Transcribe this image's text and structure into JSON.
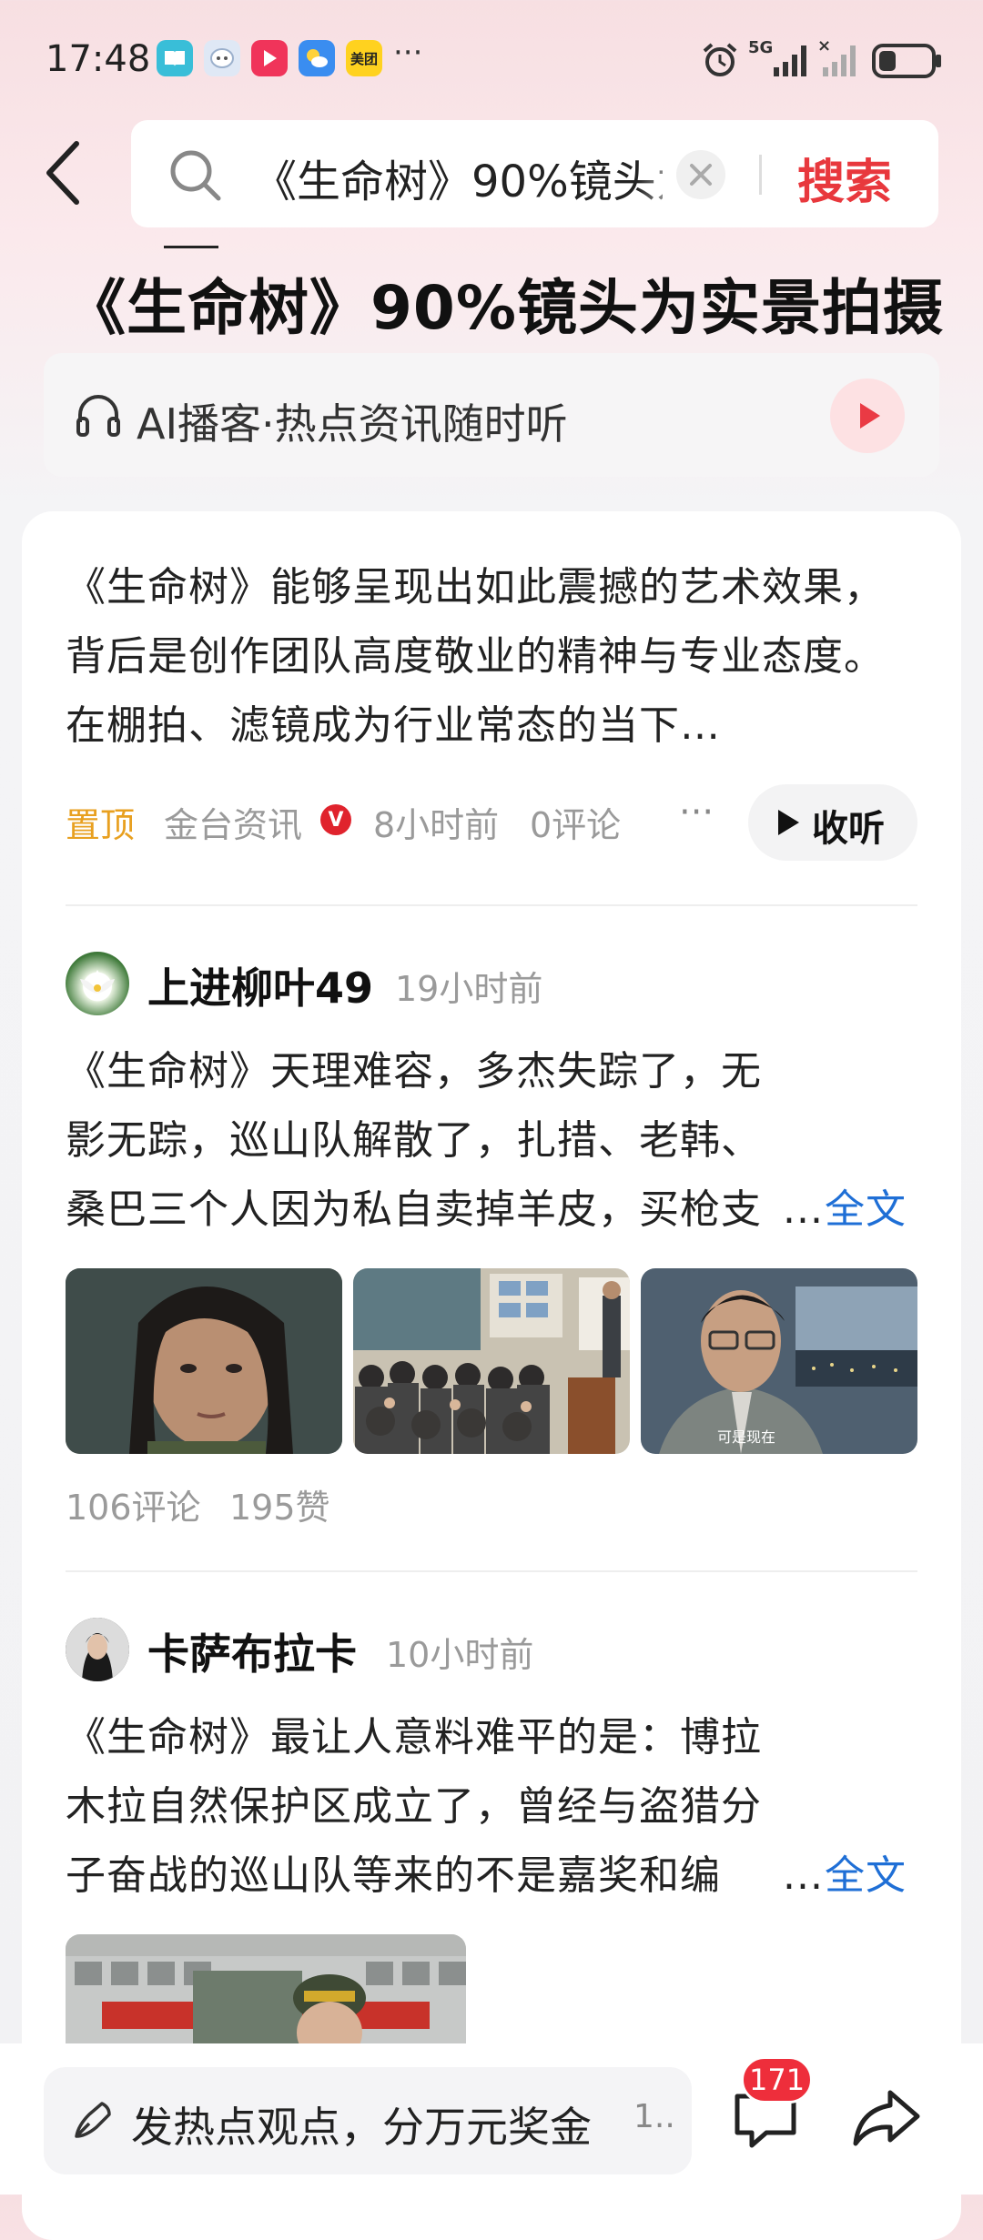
{
  "status_bar": {
    "time": "17:48",
    "app_icons": [
      {
        "name": "reader-app-icon",
        "color": "#3cc0d8"
      },
      {
        "name": "chat-app-icon",
        "color": "#d9e6f7"
      },
      {
        "name": "video-app-icon",
        "color": "#f0345a"
      },
      {
        "name": "weather-app-icon",
        "color": "#3a8df0"
      },
      {
        "name": "meituan-app-icon",
        "color": "#ffd21f",
        "label": "美团"
      }
    ],
    "more": "···",
    "net1": "5G",
    "net2": "×",
    "battery_level": 0.3
  },
  "search": {
    "query": "《生命树》90%镜头为实景拍摄",
    "button": "搜索"
  },
  "page": {
    "title": "《生命树》90%镜头为实景拍摄",
    "ai_podcast": "AI播客·热点资讯随时听"
  },
  "top_article": {
    "text": "《生命树》能够呈现出如此震撼的艺术效果，背后是创作团队高度敬业的精神与专业态度。在棚拍、滤镜成为行业常态的当下…",
    "pin": "置顶",
    "source": "金台资讯",
    "verified": "V",
    "time": "8小时前",
    "comments": "0评论",
    "more": "···",
    "listen": "收听"
  },
  "posts": [
    {
      "user": "上进柳叶49",
      "time": "19小时前",
      "text": "《生命树》天理难容，多杰失踪了，无影无踪，巡山队解散了，扎措、老韩、桑巴三个人因为私自卖掉羊皮，买枪支和子",
      "ellipsis": "...",
      "full": "全文",
      "images": [
        {
          "name": "still-woman-closeup"
        },
        {
          "name": "still-meeting-room"
        },
        {
          "name": "still-man-glasses",
          "caption": "可是现在"
        }
      ],
      "comments": "106评论",
      "likes": "195赞"
    },
    {
      "user": "卡萨布拉卡",
      "time": "10小时前",
      "text": "《生命树》最让人意料难平的是：博拉木拉自然保护区成立了，曾经与盗猎分子奋战的巡山队等来的不是嘉奖和编制，而是",
      "ellipsis": "...",
      "full": "全文"
    }
  ],
  "bottom_bar": {
    "placeholder": "发热点观点，分万元奖金",
    "placeholder_more": "1..",
    "comment_count": "171"
  },
  "colors": {
    "accent_red": "#e8383d",
    "pin_orange": "#e8a020",
    "link_blue": "#1f6fd6"
  }
}
